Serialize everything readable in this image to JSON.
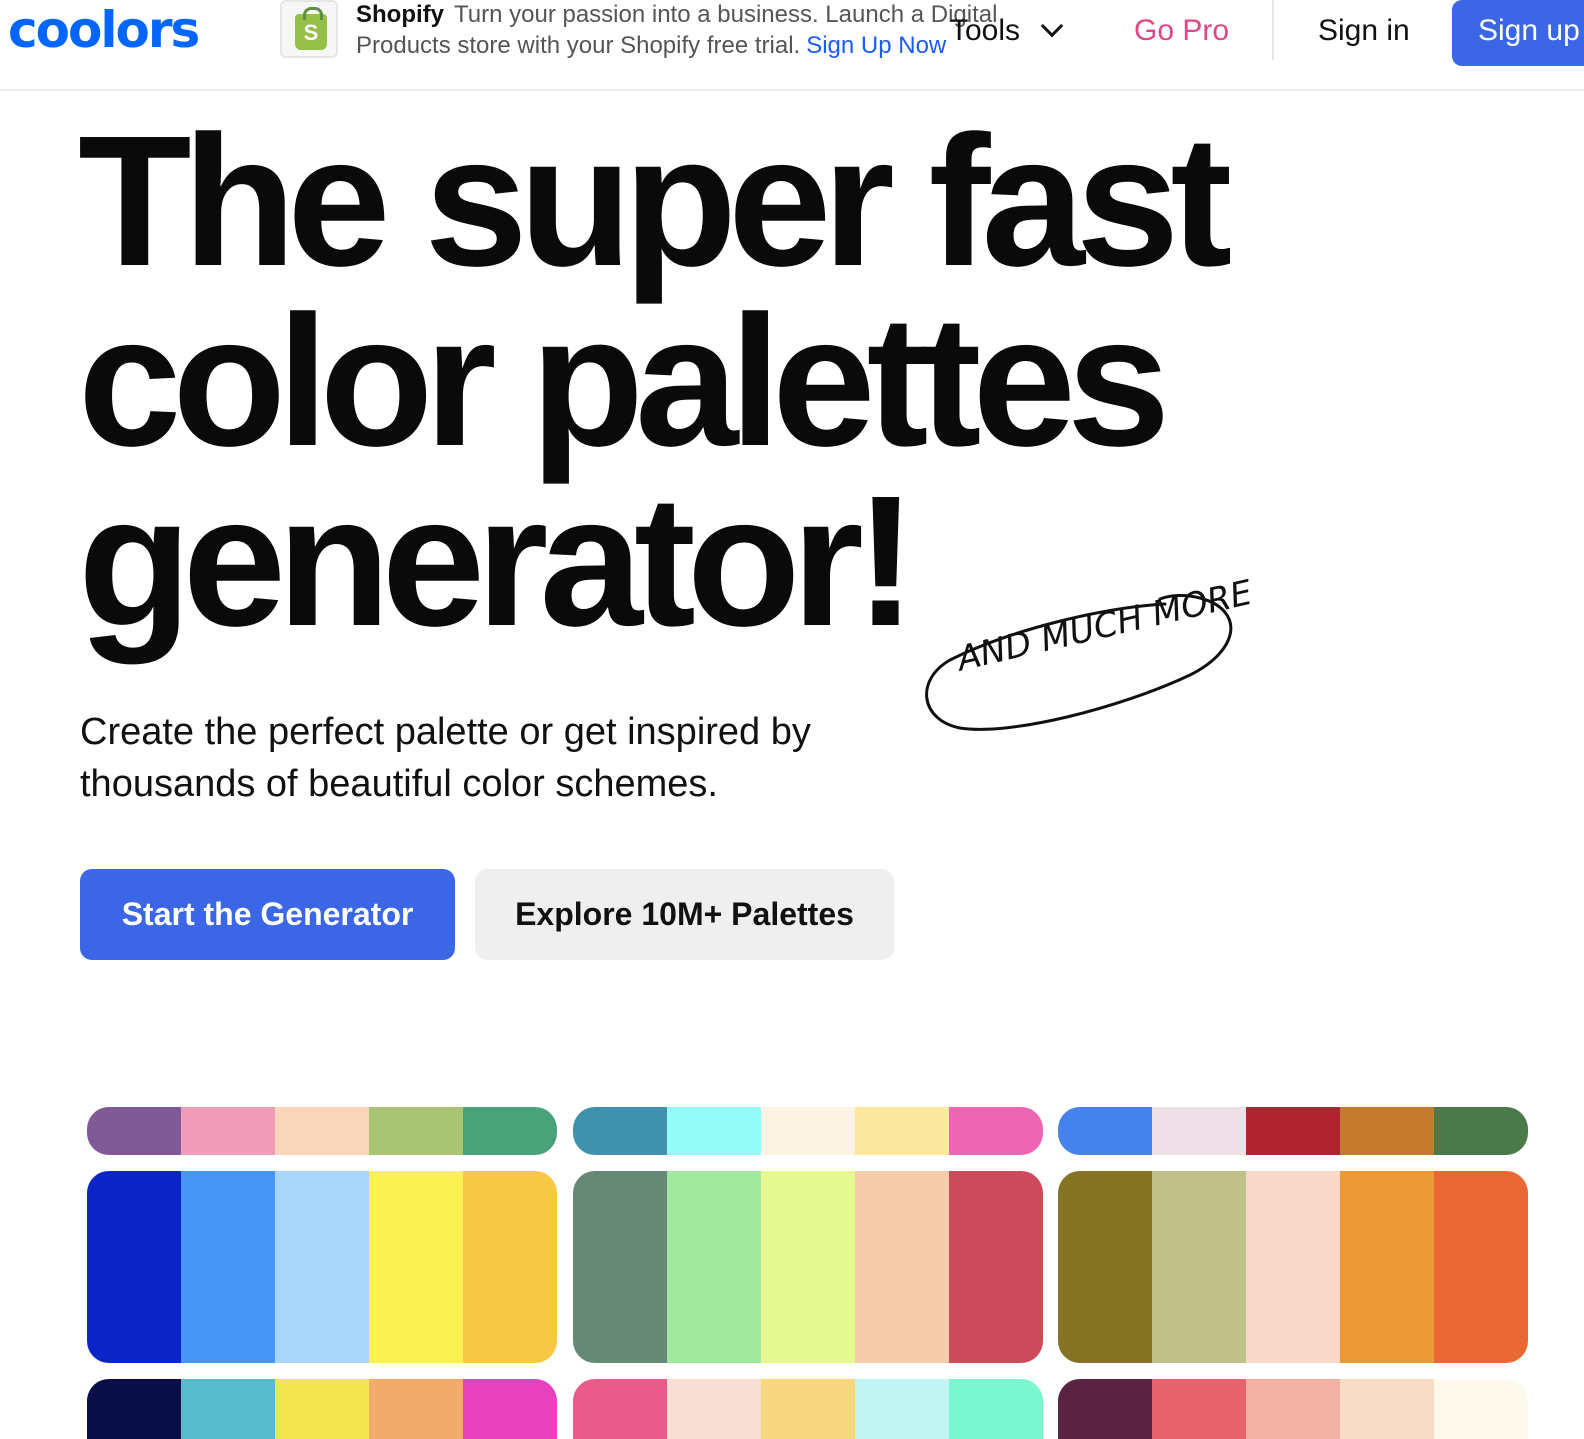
{
  "header": {
    "logo": "coolors",
    "ad": {
      "brand": "Shopify",
      "text_line": "Turn your passion into a business. Launch a Digital Products store with your Shopify free trial.",
      "link": "Sign Up Now"
    },
    "nav": {
      "tools": "Tools",
      "go_pro": "Go Pro",
      "sign_in": "Sign in",
      "sign_up": "Sign up"
    }
  },
  "hero": {
    "title_lines": [
      "The super fast",
      "color palettes",
      "generator!"
    ],
    "badge": "AND MUCH MORE",
    "subtitle": "Create the perfect palette or get inspired by thousands of beautiful color schemes.",
    "primary_button": "Start the Generator",
    "secondary_button": "Explore 10M+ Palettes"
  },
  "colors": {
    "accent": "#3b66e6",
    "logo": "#0066ff",
    "go_pro": "#e0468a",
    "ad_link": "#1a5cff"
  },
  "palettes": [
    [
      "#7f5a96",
      "#f09db9",
      "#f8d5bb",
      "#a8c474",
      "#4aa27b"
    ],
    [
      "#3f91ad",
      "#95fbf8",
      "#fdf4e6",
      "#fce9a0",
      "#ee65b4"
    ],
    [
      "#4682ec",
      "#efdfe7",
      "#b02330",
      "#c47b2c",
      "#4a7a4a"
    ],
    [
      "#0b25c9",
      "#4795f5",
      "#a9d5fb",
      "#faf152",
      "#f6c944"
    ],
    [
      "#678877",
      "#a1e99e",
      "#e6f990",
      "#f5cdab",
      "#cd4a5b"
    ],
    [
      "#847423",
      "#c0c28c",
      "#f8d9c9",
      "#ed9935",
      "#ea6834"
    ],
    [
      "#0a0f4a",
      "#58bccc",
      "#f5e54f",
      "#f1ac6c",
      "#e940bd"
    ],
    [
      "#ea5b8c",
      "#f9e0d6",
      "#f8d67e",
      "#c3f5f5",
      "#7bf7cf"
    ],
    [
      "#5a233f",
      "#e7636d",
      "#f3b0a4",
      "#f9dcc8",
      "#fdf9ec"
    ]
  ]
}
